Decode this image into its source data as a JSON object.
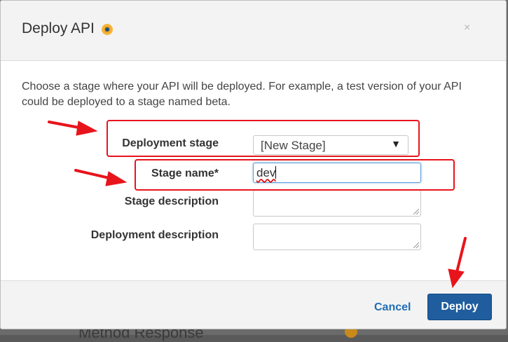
{
  "modal": {
    "title": "Deploy API",
    "close_label": "×",
    "description": "Choose a stage where your API will be deployed. For example, a test version of your API could be deployed to a stage named beta."
  },
  "form": {
    "deployment_stage_label": "Deployment stage",
    "deployment_stage_value": "[New Stage]",
    "stage_name_label": "Stage name*",
    "stage_name_value": "dev",
    "stage_description_label": "Stage description",
    "deployment_description_label": "Deployment description"
  },
  "footer": {
    "cancel_label": "Cancel",
    "deploy_label": "Deploy"
  },
  "background": {
    "partial_text": "Method Response"
  },
  "icons": {
    "title_icon": "info-dot-icon",
    "select_arrow": "triangle-down-icon",
    "close": "close-icon"
  },
  "colors": {
    "annotation": "#e8141c",
    "primary_button": "#1f5d9e",
    "link": "#1f6eb5"
  }
}
